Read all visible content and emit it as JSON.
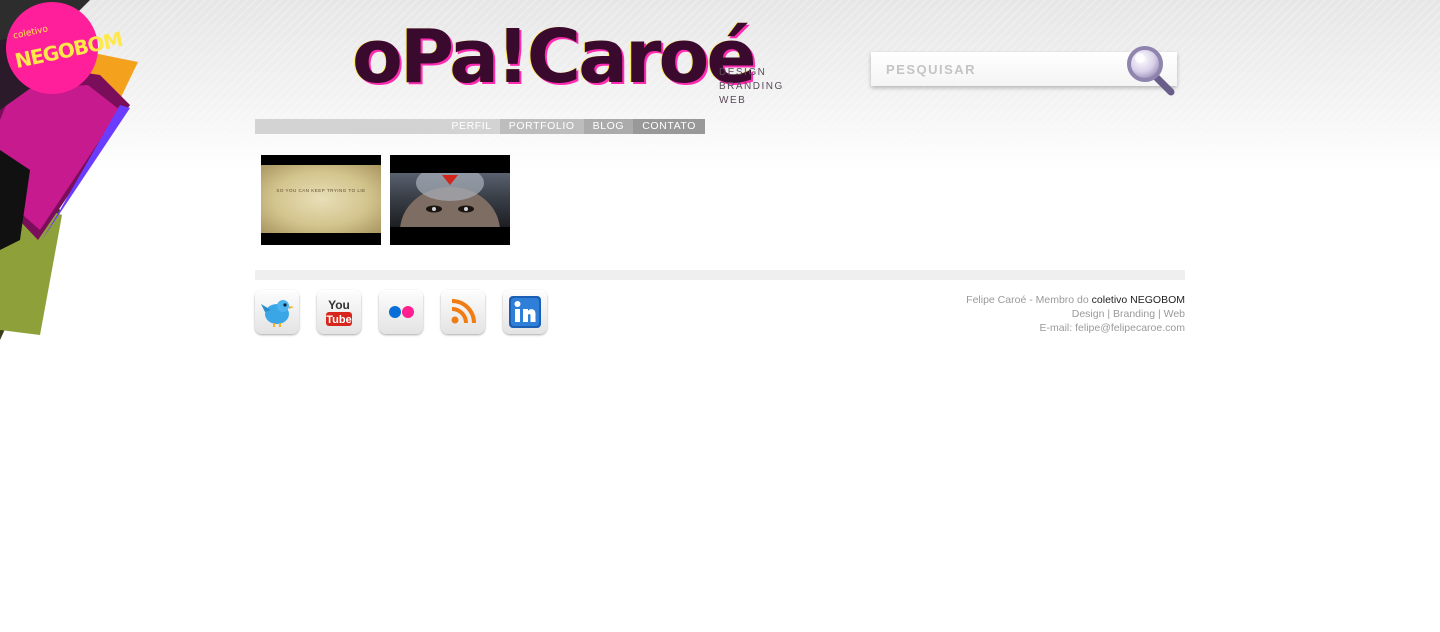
{
  "brand": {
    "badge_small": "coletivo",
    "badge_big": "NEGOBOM",
    "logo": "oPa!Caroé",
    "tagline": [
      "DESIGN",
      "BRANDING",
      "WEB"
    ]
  },
  "search": {
    "placeholder": "PESQUISAR",
    "icon": "magnifier-icon"
  },
  "nav": {
    "items": [
      "PERFIL",
      "PORTFOLIO",
      "BLOG",
      "CONTATO"
    ]
  },
  "thumbs": [
    {
      "caption": "SO YOU CAN KEEP TRYING TO LIE"
    },
    {
      "caption": ""
    }
  ],
  "social": [
    "twitter-icon",
    "youtube-icon",
    "flickr-icon",
    "rss-icon",
    "linkedin-icon"
  ],
  "youtube_text": {
    "top": "You",
    "bottom": "Tube"
  },
  "footer": {
    "line1_prefix": "Felipe Caroé - Membro do ",
    "line1_link": "coletivo NEGOBOM",
    "design": "Design",
    "branding": "Branding",
    "web": "Web",
    "sep": " | ",
    "email_label": "E-mail: ",
    "email": "felipe@felipecaroe.com"
  },
  "colors": {
    "logo": "#3a0a2e",
    "logo_shadow": "#ff2bb0",
    "accent_yellow": "#ffe84a"
  }
}
